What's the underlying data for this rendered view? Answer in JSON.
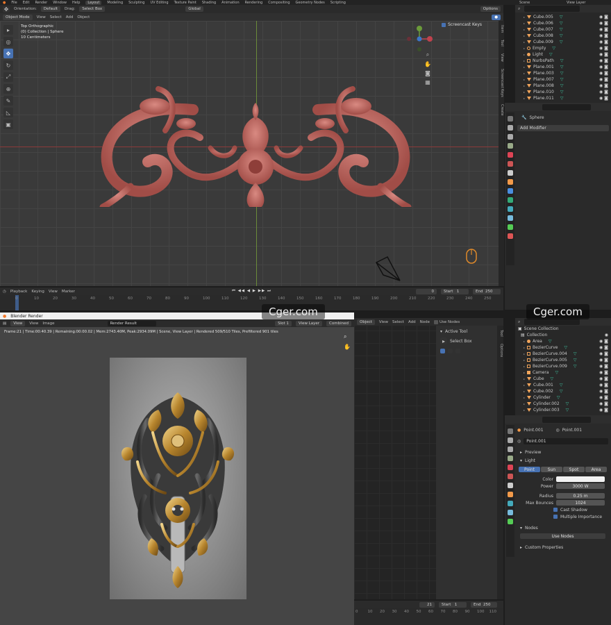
{
  "top_menu": {
    "items": [
      "File",
      "Edit",
      "Render",
      "Window",
      "Help"
    ],
    "workspaces": [
      "Layout",
      "Modeling",
      "Sculpting",
      "UV Editing",
      "Texture Paint",
      "Shading",
      "Animation",
      "Rendering",
      "Compositing",
      "Geometry Nodes",
      "Scripting"
    ],
    "active_workspace": "Layout",
    "scene": "Scene",
    "view_layer": "View Layer"
  },
  "viewport_header": {
    "orientation_label": "Orientation:",
    "orientation_value": "Default",
    "drag_label": "Drag:",
    "drag_value": "Select Box",
    "mode": "Object Mode",
    "menus": [
      "View",
      "Select",
      "Add",
      "Object"
    ],
    "transform": "Global",
    "options": "Options"
  },
  "viewport_overlay": {
    "view_name": "Top Orthographic",
    "collection_line": "(0) Collection | Sphere",
    "scale_line": "10 Centimeters"
  },
  "screencast": {
    "label": "Screencast Keys"
  },
  "side_tabs": [
    "Item",
    "Tool",
    "View",
    "Screencast Keys",
    "Create"
  ],
  "timeline": {
    "menus": [
      "Playback",
      "Keying",
      "View",
      "Marker"
    ],
    "current": "0",
    "start_label": "Start",
    "start": "1",
    "end_label": "End",
    "end": "250",
    "ruler": [
      "0",
      "10",
      "20",
      "30",
      "40",
      "50",
      "60",
      "70",
      "80",
      "90",
      "100",
      "110",
      "120",
      "130",
      "140",
      "150",
      "160",
      "170",
      "180",
      "190",
      "200",
      "210",
      "220",
      "230",
      "240",
      "250"
    ]
  },
  "outliner_top": {
    "rows": [
      {
        "name": "Cube.005",
        "kind": "mesh"
      },
      {
        "name": "Cube.006",
        "kind": "mesh"
      },
      {
        "name": "Cube.007",
        "kind": "mesh"
      },
      {
        "name": "Cube.008",
        "kind": "mesh"
      },
      {
        "name": "Cube.009",
        "kind": "mesh"
      },
      {
        "name": "Empty",
        "kind": "empty"
      },
      {
        "name": "Light",
        "kind": "light"
      },
      {
        "name": "NurbsPath",
        "kind": "curve"
      },
      {
        "name": "Plane.001",
        "kind": "mesh"
      },
      {
        "name": "Plane.003",
        "kind": "mesh"
      },
      {
        "name": "Plane.007",
        "kind": "mesh"
      },
      {
        "name": "Plane.008",
        "kind": "mesh"
      },
      {
        "name": "Plane.010",
        "kind": "mesh"
      },
      {
        "name": "Plane.011",
        "kind": "mesh"
      }
    ]
  },
  "modifier_panel": {
    "object_name": "Sphere",
    "add_modifier": "Add Modifier"
  },
  "render_window": {
    "title": "Blender Render",
    "menus": [
      "View",
      "View",
      "Image"
    ],
    "image_name": "Render Result",
    "slot": "Slot 1",
    "layer": "View Layer",
    "pass": "Combined",
    "status": "Frame:21 | Time:00:40.39 | Remaining:00:00.02 | Mem:2743.40M, Peak:2934.09M | Scene, View Layer | Rendered 509/510 Tiles, Prefiltered 901 tiles"
  },
  "node_editor": {
    "menus": [
      "Object",
      "View",
      "Select",
      "Add",
      "Node"
    ],
    "use_nodes": "Use Nodes",
    "active_tool_label": "Active Tool",
    "tool_name": "Select Box",
    "tabs": [
      "Tool",
      "Options"
    ],
    "frame_current": "21",
    "start_label": "Start",
    "start": "1",
    "end_label": "End",
    "end": "250",
    "ruler": [
      "0",
      "10",
      "20",
      "30",
      "40",
      "50",
      "60",
      "70",
      "80",
      "90",
      "100",
      "110"
    ]
  },
  "outliner_bottom": {
    "header": "Scene Collection",
    "collection": "Collection",
    "rows": [
      {
        "name": "Area",
        "kind": "light"
      },
      {
        "name": "BezierCurve",
        "kind": "curve"
      },
      {
        "name": "BezierCurve.004",
        "kind": "curve"
      },
      {
        "name": "BezierCurve.005",
        "kind": "curve"
      },
      {
        "name": "BezierCurve.009",
        "kind": "curve"
      },
      {
        "name": "Camera",
        "kind": "camera"
      },
      {
        "name": "Cube",
        "kind": "mesh"
      },
      {
        "name": "Cube.001",
        "kind": "mesh"
      },
      {
        "name": "Cube.002",
        "kind": "mesh"
      },
      {
        "name": "Cylinder",
        "kind": "mesh"
      },
      {
        "name": "Cylinder.002",
        "kind": "mesh"
      },
      {
        "name": "Cylinder.003",
        "kind": "mesh"
      }
    ]
  },
  "light_props": {
    "object": "Point.001",
    "data": "Point.001",
    "data_field": "Point.001",
    "preview": "Preview",
    "light_section": "Light",
    "types": [
      "Point",
      "Sun",
      "Spot",
      "Area"
    ],
    "active_type": "Point",
    "color_label": "Color",
    "power_label": "Power",
    "power": "3000 W",
    "radius_label": "Radius",
    "radius": "0.25 m",
    "bounces_label": "Max Bounces",
    "bounces": "1024",
    "cast_shadow": "Cast Shadow",
    "multiple_importance": "Multiple Importance",
    "nodes_section": "Nodes",
    "use_nodes": "Use Nodes",
    "custom_props": "Custom Properties"
  },
  "watermark": {
    "text_1": "Cger.com",
    "text_2": "Cger.com"
  },
  "colors": {
    "accent": "#4772b3",
    "ornament": "#c96a63",
    "grid_x": "#8c3a3a",
    "grid_y": "#6b8c3a",
    "gold": "#c89a3a"
  }
}
